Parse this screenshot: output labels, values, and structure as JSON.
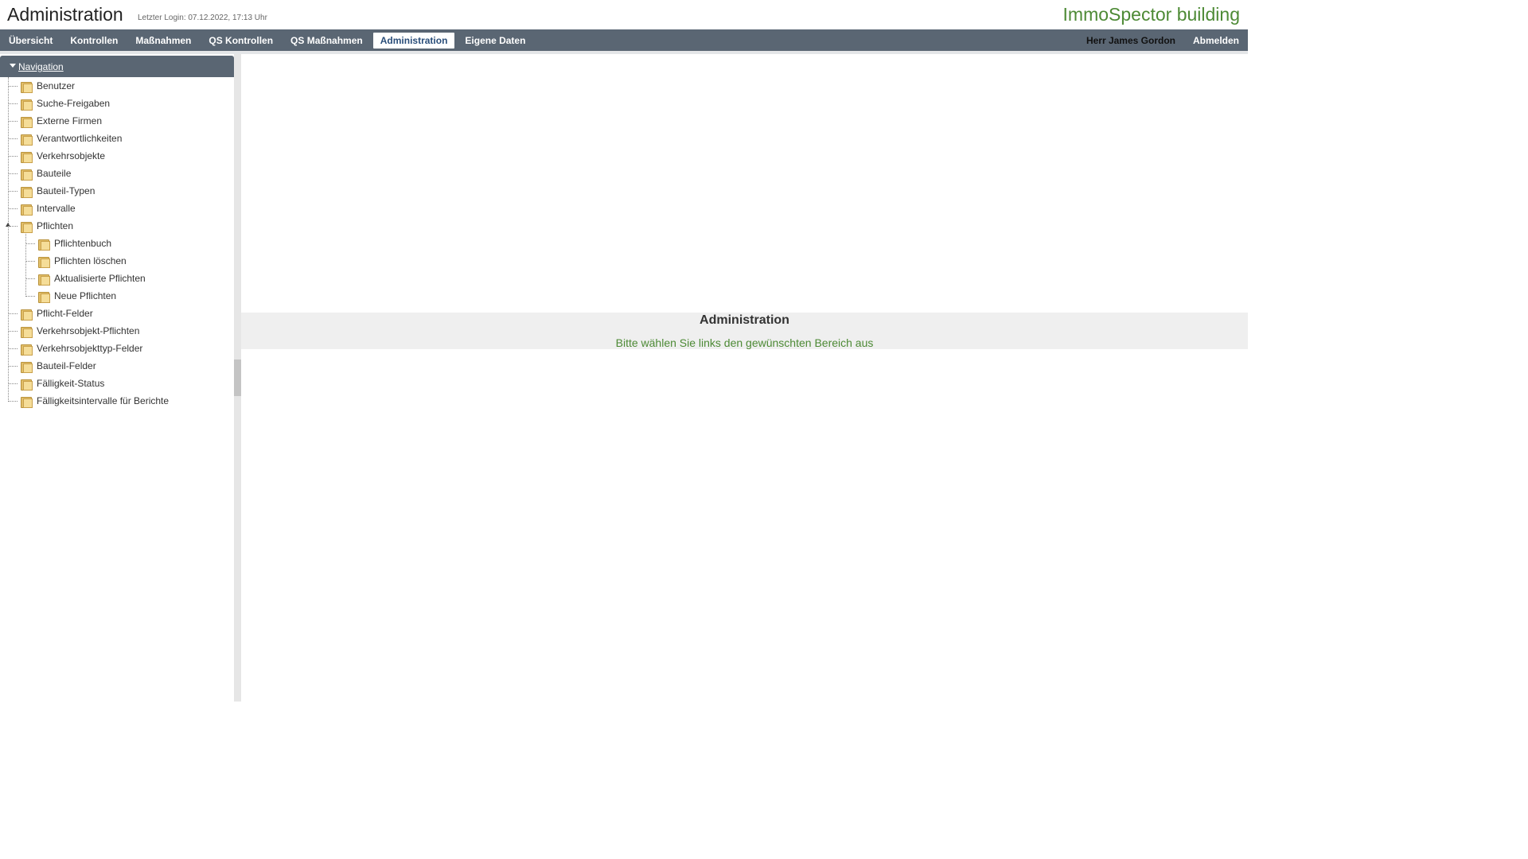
{
  "header": {
    "title": "Administration",
    "last_login": "Letzter Login: 07.12.2022, 17:13 Uhr",
    "brand": "ImmoSpector building"
  },
  "menu": {
    "items": [
      "Übersicht",
      "Kontrollen",
      "Maßnahmen",
      "QS Kontrollen",
      "QS Maßnahmen",
      "Administration",
      "Eigene Daten"
    ],
    "active": "Administration",
    "user": "Herr James Gordon",
    "logout": "Abmelden"
  },
  "sidebar": {
    "title": "Navigation",
    "items": [
      "Benutzer",
      "Suche-Freigaben",
      "Externe Firmen",
      "Verantwortlichkeiten",
      "Verkehrsobjekte",
      "Bauteile",
      "Bauteil-Typen",
      "Intervalle",
      "Pflichten",
      "Pflicht-Felder",
      "Verkehrsobjekt-Pflichten",
      "Verkehrsobjekttyp-Felder",
      "Bauteil-Felder",
      "Fälligkeit-Status",
      "Fälligkeitsintervalle für Berichte"
    ],
    "pflichten_children": [
      "Pflichtenbuch",
      "Pflichten löschen",
      "Aktualisierte Pflichten",
      "Neue Pflichten"
    ]
  },
  "main": {
    "title": "Administration",
    "message": "Bitte wählen Sie links den gewünschten Bereich aus"
  },
  "colors": {
    "brand_green": "#4d8a35",
    "menubar": "#5a6673",
    "active_menu_text": "#2a4e7a"
  }
}
